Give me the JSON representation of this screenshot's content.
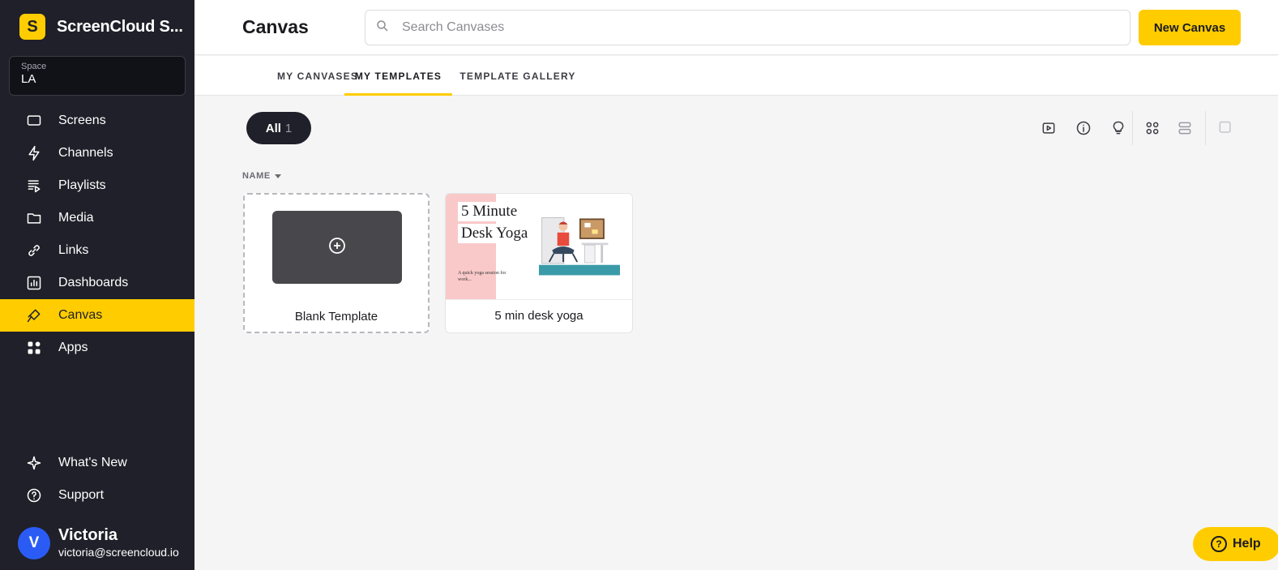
{
  "sidebar": {
    "brand_letter": "S",
    "brand_name": "ScreenCloud S...",
    "space_label": "Space",
    "space_value": "LA",
    "items": [
      {
        "label": "Screens",
        "icon": "screen-icon"
      },
      {
        "label": "Channels",
        "icon": "lightning-icon"
      },
      {
        "label": "Playlists",
        "icon": "playlist-icon"
      },
      {
        "label": "Media",
        "icon": "folder-icon"
      },
      {
        "label": "Links",
        "icon": "link-icon"
      },
      {
        "label": "Dashboards",
        "icon": "chart-icon"
      },
      {
        "label": "Canvas",
        "icon": "brush-icon",
        "active": true
      },
      {
        "label": "Apps",
        "icon": "apps-icon"
      }
    ],
    "bottom_items": [
      {
        "label": "What's New",
        "icon": "sparkle-icon"
      },
      {
        "label": "Support",
        "icon": "help-circle-icon"
      }
    ],
    "user": {
      "initial": "V",
      "name": "Victoria",
      "email": "victoria@screencloud.io"
    }
  },
  "header": {
    "title": "Canvas",
    "search_placeholder": "Search Canvases",
    "new_button": "New Canvas"
  },
  "tabs": [
    {
      "label": "MY CANVASES",
      "active": false
    },
    {
      "label": "MY TEMPLATES",
      "active": true
    },
    {
      "label": "TEMPLATE GALLERY",
      "active": false
    }
  ],
  "filter": {
    "label": "All",
    "count": "1"
  },
  "sort_label": "NAME",
  "cards": {
    "blank_label": "Blank Template",
    "yoga": {
      "title_line1": "5 Minute",
      "title_line2": "Desk Yoga",
      "subtitle": "A quick yoga session for work...",
      "label": "5 min desk yoga"
    }
  },
  "help_label": "Help",
  "colors": {
    "accent": "#ffcc00",
    "sidebar_bg": "#1f2029",
    "avatar": "#2a5cf5"
  }
}
